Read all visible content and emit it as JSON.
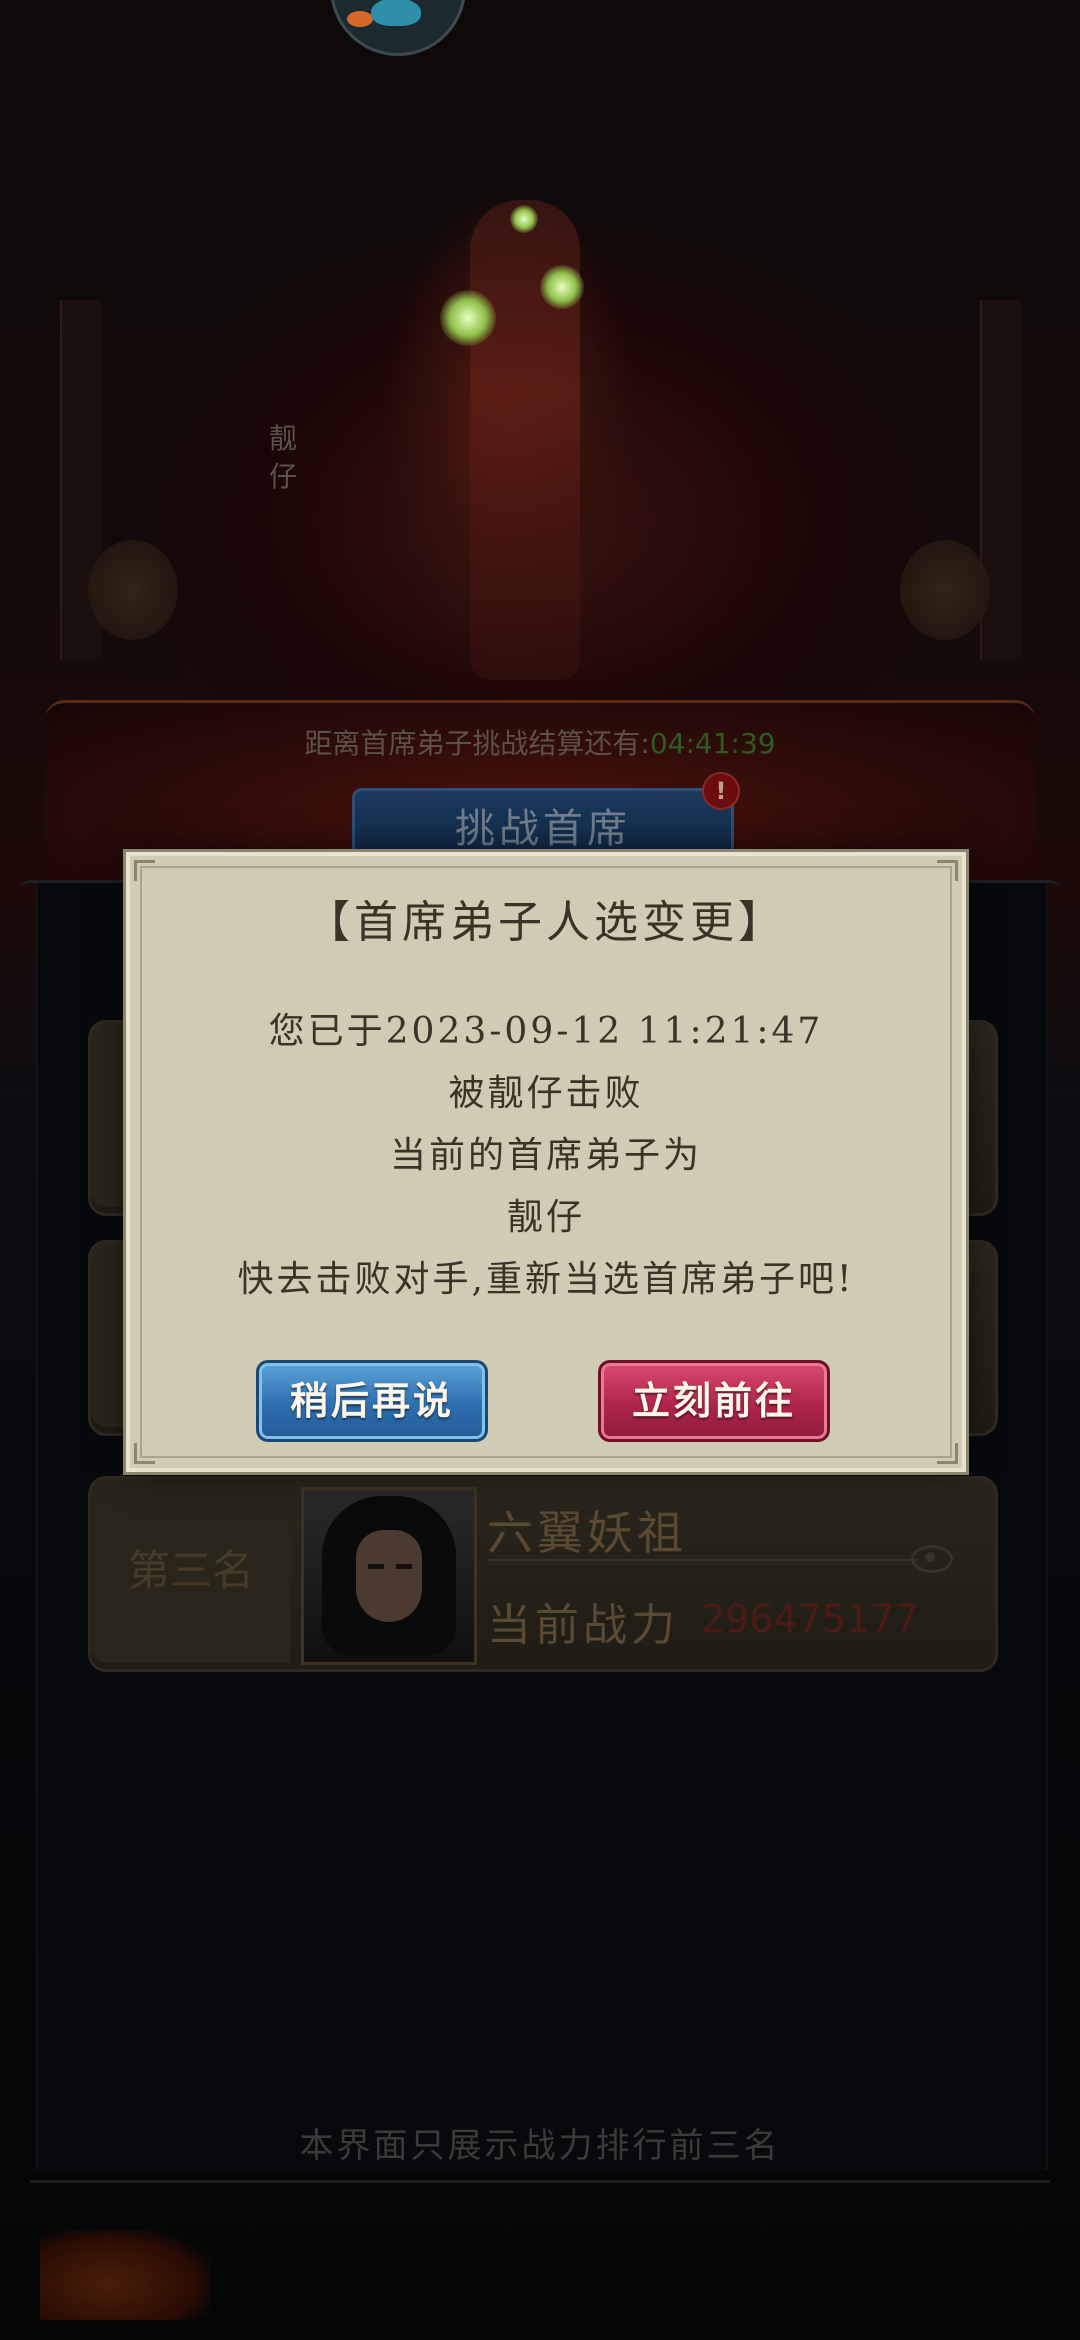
{
  "background": {
    "side_name": "靓仔",
    "countdown_label": "距离首席弟子挑战结算还有:",
    "countdown_time": "04:41:39",
    "challenge_button": "挑战首席",
    "alert_badge": "!"
  },
  "ranking": {
    "third_place": {
      "rank_label": "第三名",
      "player_name": "六翼妖祖",
      "power_label": "当前战力",
      "power_value": "296475177"
    },
    "footer_note": "本界面只展示战力排行前三名"
  },
  "dialog": {
    "title": "【首席弟子人选变更】",
    "line1": "您已于2023-09-12 11:21:47",
    "line2": "被靓仔击败",
    "line3": "当前的首席弟子为",
    "line4": "靓仔",
    "line5": "快去击败对手,重新当选首席弟子吧!",
    "later_button": "稍后再说",
    "go_button": "立刻前往"
  },
  "colors": {
    "dialog_bg": "#cfcbb4",
    "later_button": "#2f6fb0",
    "go_button": "#b0264a",
    "countdown_time": "#2f5a24",
    "power_value": "#4c1a14"
  }
}
